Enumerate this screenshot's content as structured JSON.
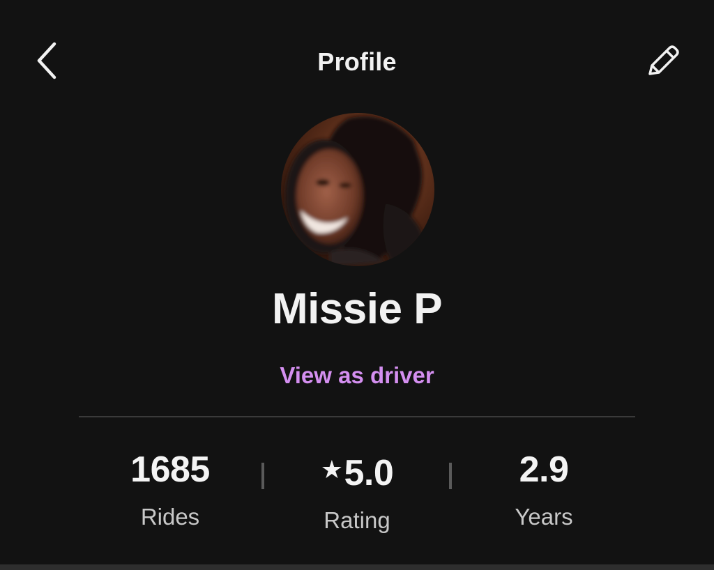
{
  "header": {
    "title": "Profile",
    "back_icon": "chevron-left-icon",
    "edit_icon": "pencil-icon"
  },
  "profile": {
    "name": "Missie P",
    "view_as_driver_label": "View as driver"
  },
  "stats": [
    {
      "value": "1685",
      "label": "Rides"
    },
    {
      "value": "5.0",
      "label": "Rating",
      "icon": "star-icon"
    },
    {
      "value": "2.9",
      "label": "Years"
    }
  ],
  "colors": {
    "background": "#121212",
    "accent": "#d48ff0",
    "text": "#f2f2f2",
    "muted": "#c8c8c8"
  }
}
